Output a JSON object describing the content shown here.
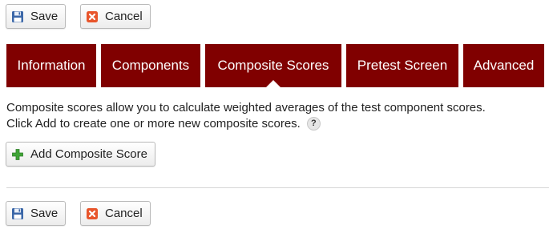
{
  "top_toolbar": {
    "save_label": "Save",
    "cancel_label": "Cancel"
  },
  "tabs": [
    {
      "label": "Information",
      "active": false
    },
    {
      "label": "Components",
      "active": false
    },
    {
      "label": "Composite Scores",
      "active": true
    },
    {
      "label": "Pretest Screen",
      "active": false
    },
    {
      "label": "Advanced",
      "active": false
    }
  ],
  "description": {
    "line1": "Composite scores allow you to calculate weighted averages of the test component scores.",
    "line2": "Click Add to create one or more new composite scores.",
    "help_glyph": "?"
  },
  "add_button_label": "Add Composite Score",
  "bottom_toolbar": {
    "save_label": "Save",
    "cancel_label": "Cancel"
  },
  "colors": {
    "tab_bg": "#800000",
    "tab_text": "#ffffff",
    "cancel_icon": "#e8552b",
    "add_icon": "#3fa536",
    "save_icon": "#3b67a8"
  },
  "icons": {
    "save": "floppy-disk-icon",
    "cancel": "close-icon",
    "add": "plus-icon",
    "help": "help-icon"
  }
}
